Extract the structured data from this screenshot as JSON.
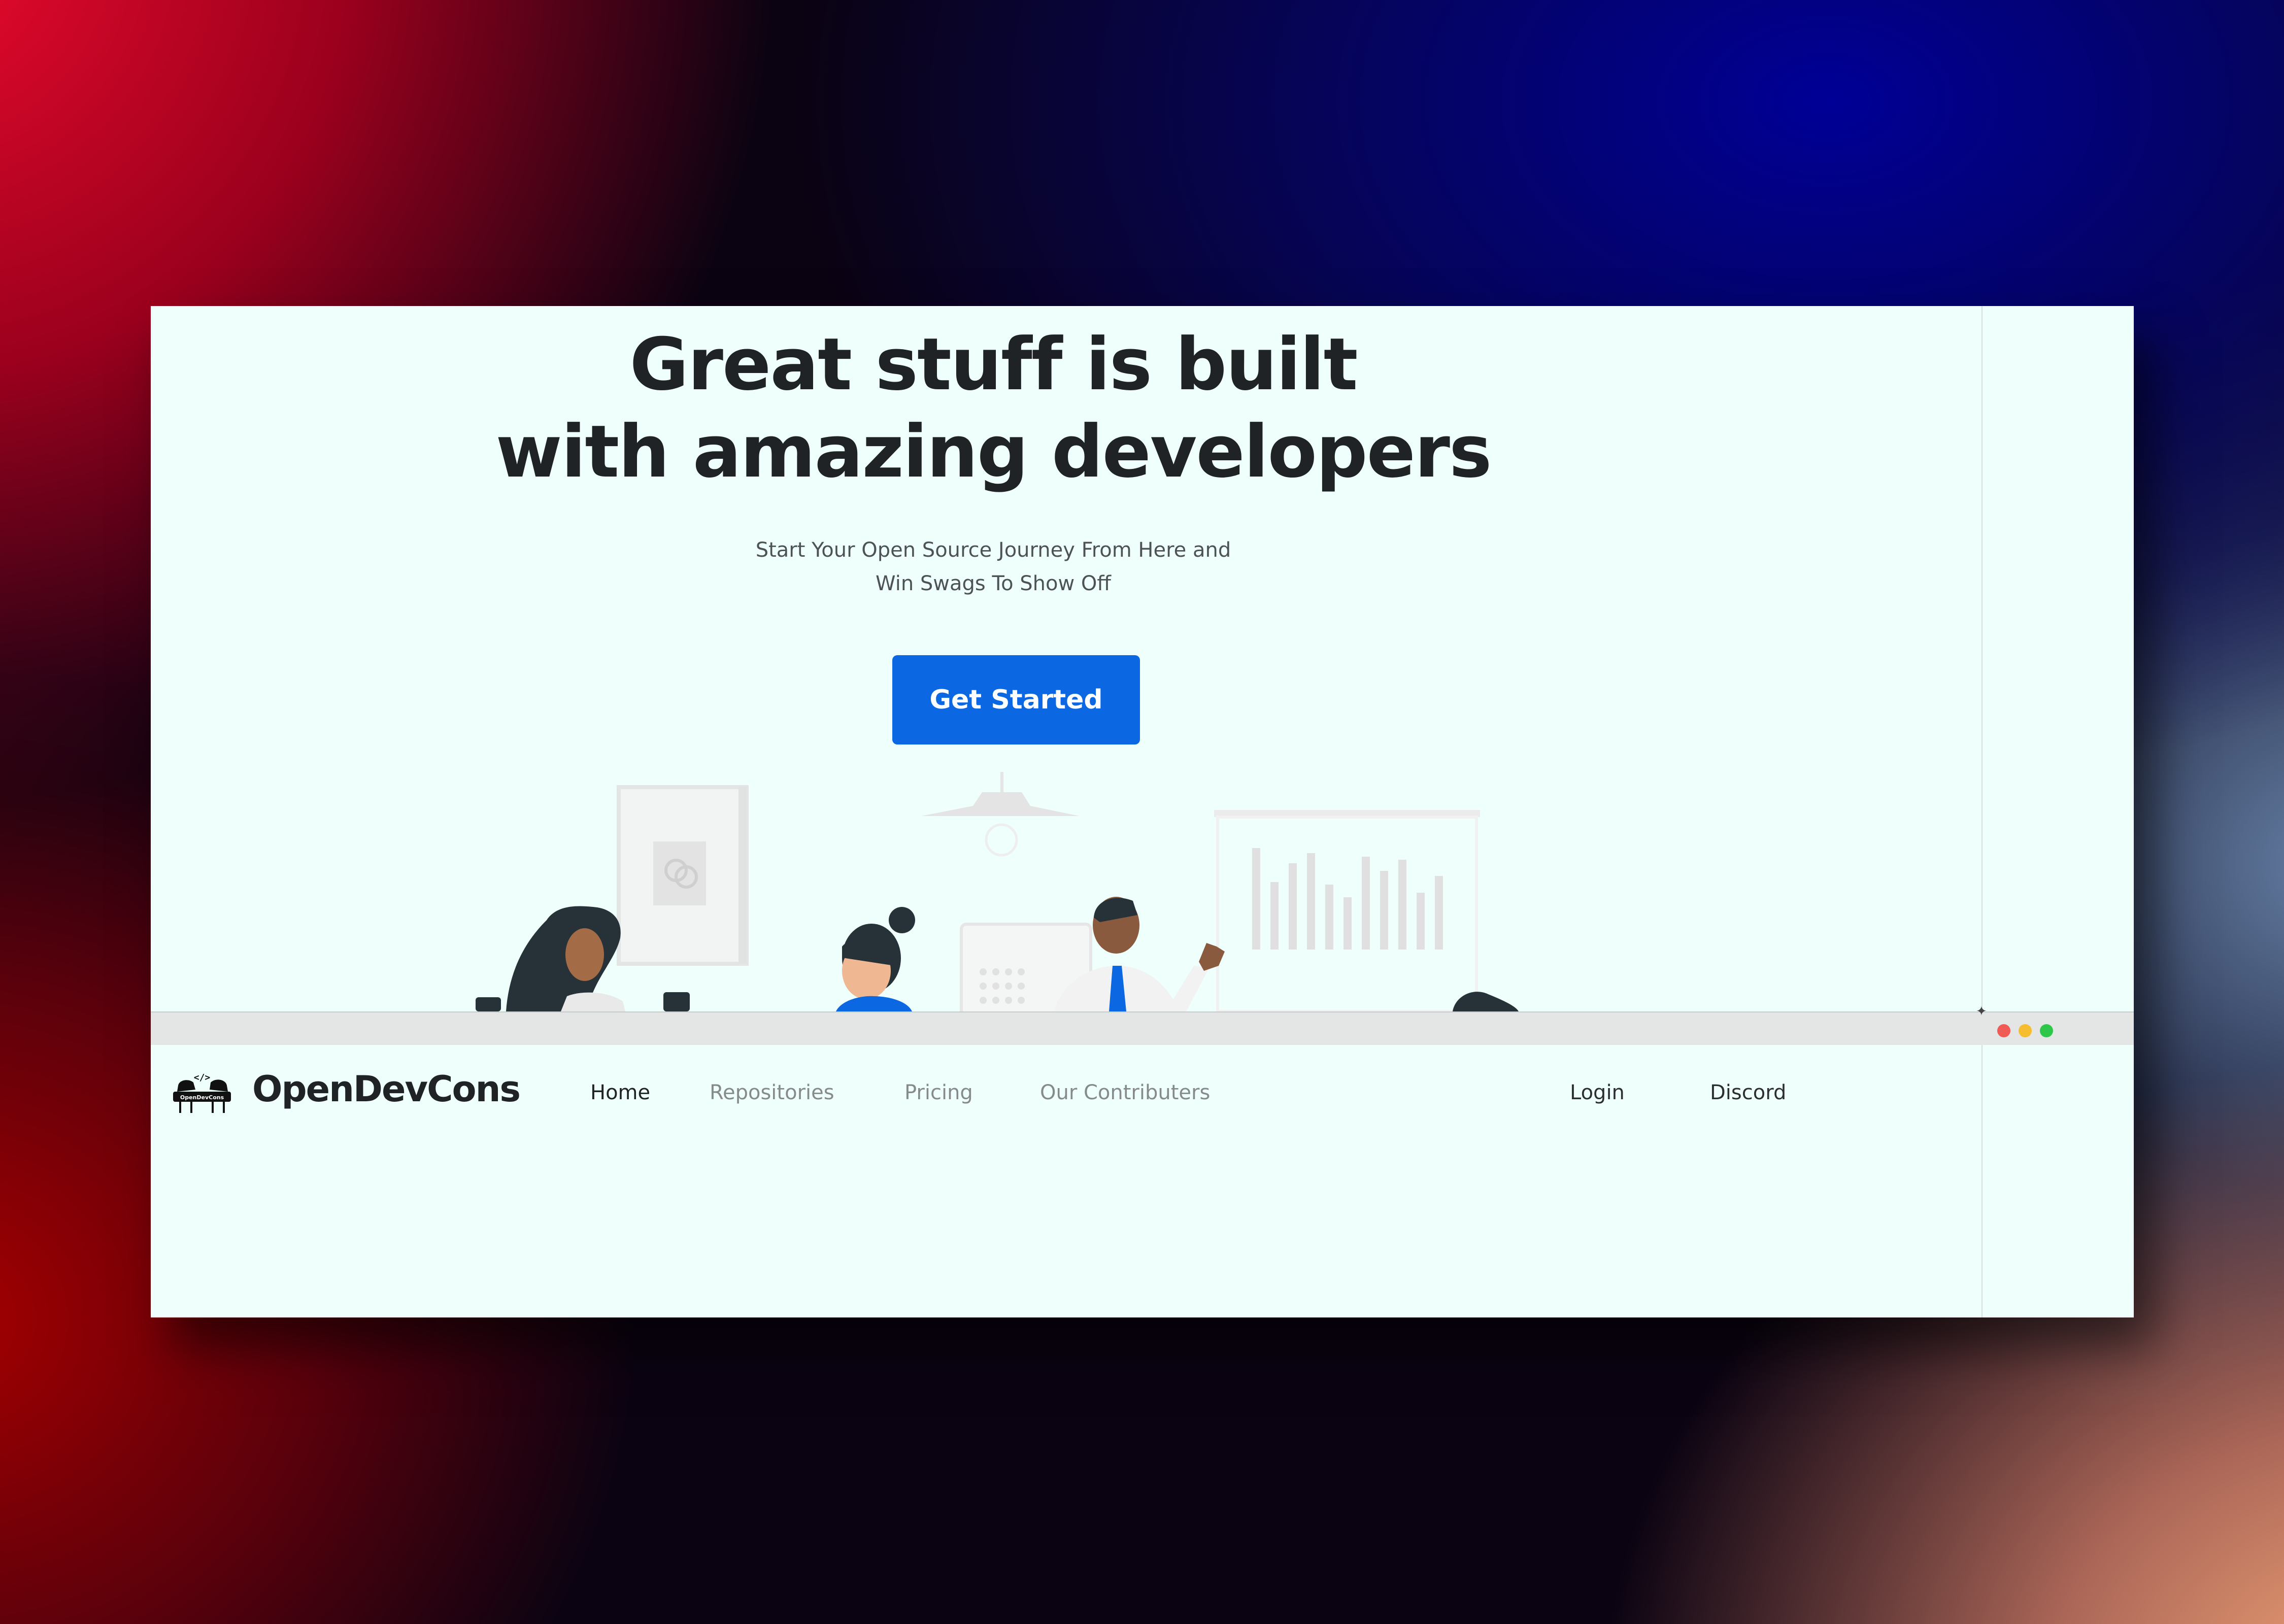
{
  "hero": {
    "title_line1": "Great stuff is built",
    "title_line2": "with amazing developers",
    "subtitle_line1": "Start Your Open Source Journey From Here and",
    "subtitle_line2": "Win Swags To Show Off",
    "cta_label": "Get Started"
  },
  "brand": {
    "name": "OpenDevCons",
    "logo_text": "OpenDevCons",
    "logo_glyph": "</>"
  },
  "nav": {
    "items": [
      {
        "label": "Home",
        "active": true
      },
      {
        "label": "Repositories",
        "active": false
      },
      {
        "label": "Pricing",
        "active": false
      },
      {
        "label": "Our Contributers",
        "active": false
      }
    ],
    "login_label": "Login",
    "discord_label": "Discord"
  },
  "colors": {
    "page_bg": "#effffc",
    "accent": "#0c67e3",
    "heading": "#1f2326",
    "traffic_red": "#f05b55",
    "traffic_yellow": "#f6be2f",
    "traffic_green": "#2fc74a"
  },
  "icons": {
    "window_controls": [
      "close-dot",
      "minimize-dot",
      "maximize-dot"
    ],
    "logo": "developers-logo-icon"
  }
}
